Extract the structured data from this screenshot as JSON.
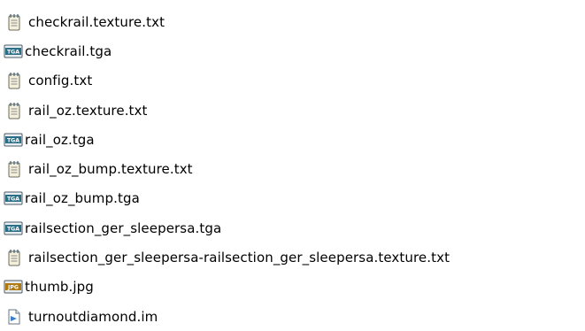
{
  "files": [
    {
      "name": "checkrail.texture.txt",
      "icon": "text-file-icon"
    },
    {
      "name": "checkrail.tga",
      "icon": "tga-file-icon",
      "badge": "TGA"
    },
    {
      "name": "config.txt",
      "icon": "text-file-icon"
    },
    {
      "name": "rail_oz.texture.txt",
      "icon": "text-file-icon"
    },
    {
      "name": "rail_oz.tga",
      "icon": "tga-file-icon",
      "badge": "TGA"
    },
    {
      "name": "rail_oz_bump.texture.txt",
      "icon": "text-file-icon"
    },
    {
      "name": "rail_oz_bump.tga",
      "icon": "tga-file-icon",
      "badge": "TGA"
    },
    {
      "name": "railsection_ger_sleepersa.tga",
      "icon": "tga-file-icon",
      "badge": "TGA"
    },
    {
      "name": "railsection_ger_sleepersa-railsection_ger_sleepersa.texture.txt",
      "icon": "text-file-icon"
    },
    {
      "name": "thumb.jpg",
      "icon": "jpg-file-icon",
      "badge": "JPG"
    },
    {
      "name": "turnoutdiamond.im",
      "icon": "im-file-icon"
    }
  ],
  "colors": {
    "tga_badge": "#2a6f86",
    "jpg_badge": "#b07a10",
    "notepad_paper": "#f4f0dc",
    "notepad_spiral": "#6b7f8f",
    "im_accent": "#3a7fd0"
  }
}
